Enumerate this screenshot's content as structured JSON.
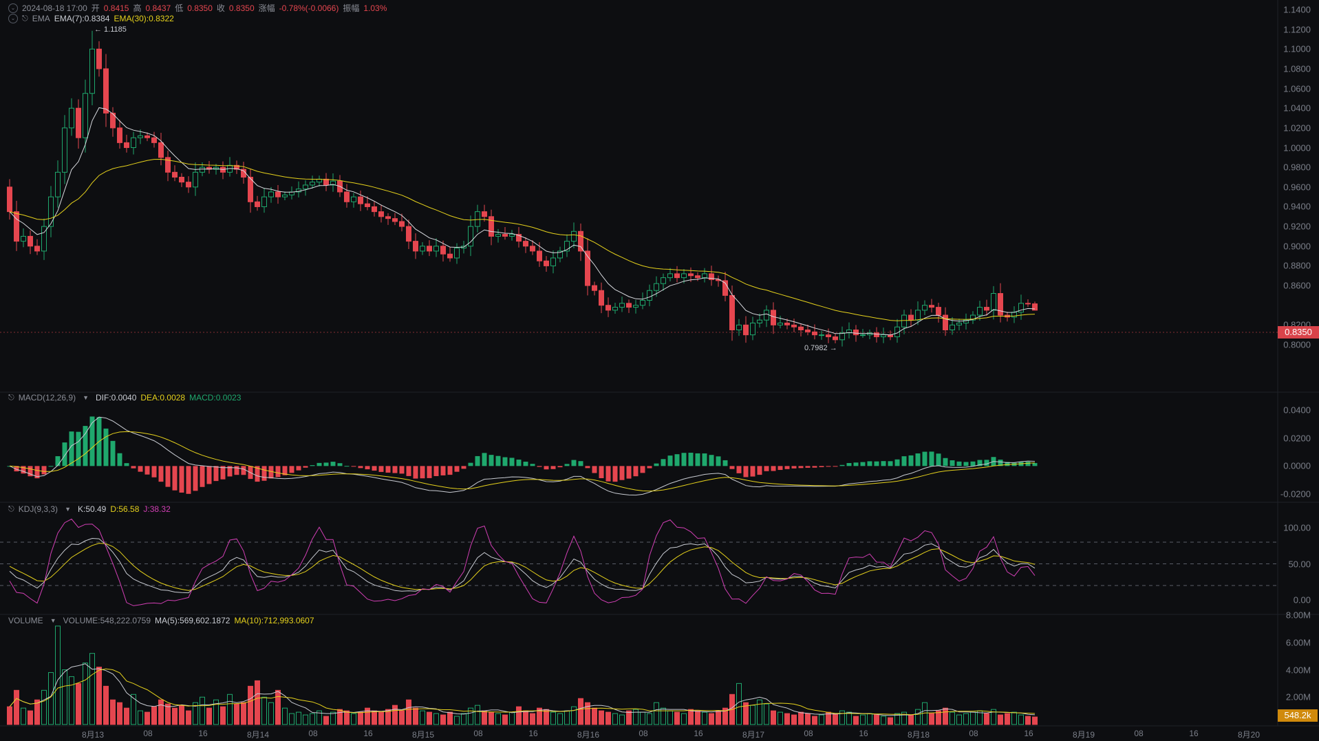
{
  "header": {
    "datetime": "2024-08-18 17:00",
    "open_label": "开",
    "open": "0.8415",
    "high_label": "高",
    "high": "0.8437",
    "low_label": "低",
    "low": "0.8350",
    "close_label": "收",
    "close": "0.8350",
    "change_label": "涨幅",
    "change": "-0.78%(-0.0066)",
    "amplitude_label": "振幅",
    "amplitude": "1.03%"
  },
  "ema_legend": {
    "name": "EMA",
    "ema7": "EMA(7):0.8384",
    "ema30": "EMA(30):0.8322"
  },
  "macd_legend": {
    "name": "MACD(12,26,9)",
    "dif": "DIF:0.0040",
    "dea": "DEA:0.0028",
    "macd": "MACD:0.0023"
  },
  "kdj_legend": {
    "name": "KDJ(9,3,3)",
    "k": "K:50.49",
    "d": "D:56.58",
    "j": "J:38.32"
  },
  "volume_legend": {
    "name": "VOLUME",
    "volume": "VOLUME:548,222.0759",
    "ma5": "MA(5):569,602.1872",
    "ma10": "MA(10):712,993.0607"
  },
  "price_axis": [
    "1.1400",
    "1.1200",
    "1.1000",
    "1.0800",
    "1.0600",
    "1.0400",
    "1.0200",
    "1.0000",
    "0.9800",
    "0.9600",
    "0.9400",
    "0.9200",
    "0.9000",
    "0.8800",
    "0.8600",
    "0.8200",
    "0.8000"
  ],
  "macd_axis": [
    "0.0400",
    "0.0200",
    "0.0000",
    "-0.0200"
  ],
  "kdj_axis": [
    "100.00",
    "50.00",
    "0.00"
  ],
  "volume_axis": [
    "8.00M",
    "6.00M",
    "4.00M",
    "2.00M"
  ],
  "current_price_tag": "0.8350",
  "current_volume_tag": "548.2k",
  "annotations": {
    "high": "← 1.1185",
    "low": "0.7982 →",
    "high_value": 1.1185,
    "low_value": 0.7982
  },
  "x_axis": [
    "8月13",
    "08",
    "16",
    "8月14",
    "08",
    "16",
    "8月15",
    "08",
    "16",
    "8月16",
    "08",
    "16",
    "8月17",
    "08",
    "16",
    "8月18",
    "08",
    "16",
    "8月19",
    "08",
    "16",
    "8月20"
  ],
  "colors": {
    "up": "#1fa86d",
    "down": "#e5464f",
    "ema7": "#d9dbe0",
    "ema30": "#e6d21c",
    "j": "#d23fb5",
    "volume_tag": "#d08a0c"
  },
  "chart_data": {
    "type": "candlestick",
    "interval": "1h",
    "first_open": 0.96,
    "last_open": 0.8415,
    "closes": [
      0.935,
      0.905,
      0.91,
      0.9,
      0.895,
      0.92,
      0.95,
      0.975,
      1.02,
      1.04,
      1.01,
      1.055,
      1.1,
      1.08,
      1.035,
      1.02,
      1.005,
      1.0,
      1.01,
      1.012,
      1.01,
      1.005,
      0.99,
      0.975,
      0.97,
      0.965,
      0.96,
      0.975,
      0.98,
      0.978,
      0.98,
      0.975,
      0.982,
      0.978,
      0.97,
      0.945,
      0.94,
      0.95,
      0.955,
      0.95,
      0.952,
      0.955,
      0.958,
      0.962,
      0.965,
      0.968,
      0.962,
      0.966,
      0.955,
      0.945,
      0.95,
      0.943,
      0.94,
      0.935,
      0.93,
      0.928,
      0.925,
      0.92,
      0.905,
      0.895,
      0.9,
      0.895,
      0.9,
      0.892,
      0.888,
      0.898,
      0.9,
      0.92,
      0.935,
      0.93,
      0.91,
      0.912,
      0.91,
      0.912,
      0.905,
      0.9,
      0.895,
      0.885,
      0.88,
      0.888,
      0.895,
      0.905,
      0.915,
      0.895,
      0.86,
      0.855,
      0.84,
      0.835,
      0.838,
      0.842,
      0.838,
      0.84,
      0.845,
      0.855,
      0.862,
      0.868,
      0.872,
      0.868,
      0.872,
      0.87,
      0.868,
      0.872,
      0.866,
      0.865,
      0.85,
      0.815,
      0.82,
      0.81,
      0.822,
      0.825,
      0.835,
      0.82,
      0.822,
      0.82,
      0.818,
      0.815,
      0.813,
      0.81,
      0.81,
      0.808,
      0.805,
      0.812,
      0.815,
      0.81,
      0.81,
      0.812,
      0.808,
      0.81,
      0.808,
      0.818,
      0.83,
      0.825,
      0.835,
      0.84,
      0.838,
      0.83,
      0.815,
      0.82,
      0.822,
      0.825,
      0.83,
      0.838,
      0.835,
      0.852,
      0.83,
      0.828,
      0.833,
      0.842,
      0.8415,
      0.835
    ],
    "volumes_m": [
      1.3,
      2.5,
      1.2,
      1.0,
      1.8,
      2.5,
      3.8,
      7.2,
      4.0,
      3.5,
      3.0,
      4.5,
      5.2,
      4.2,
      2.8,
      1.8,
      1.6,
      1.2,
      2.2,
      1.0,
      0.9,
      1.3,
      1.8,
      1.5,
      1.2,
      1.4,
      1.0,
      1.6,
      2.0,
      1.2,
      1.8,
      1.3,
      2.2,
      1.5,
      1.6,
      2.8,
      3.2,
      2.0,
      1.6,
      2.5,
      1.2,
      0.8,
      0.9,
      0.7,
      0.8,
      1.0,
      0.6,
      0.9,
      1.1,
      1.0,
      0.8,
      0.9,
      1.2,
      1.0,
      0.9,
      1.1,
      1.4,
      1.0,
      1.8,
      1.2,
      1.0,
      0.9,
      0.8,
      0.7,
      0.9,
      0.6,
      0.8,
      1.2,
      1.4,
      1.0,
      0.9,
      0.8,
      0.7,
      0.9,
      1.3,
      1.0,
      0.8,
      1.2,
      1.1,
      0.9,
      0.8,
      1.0,
      1.3,
      1.9,
      1.6,
      1.2,
      1.0,
      0.9,
      0.8,
      0.7,
      1.0,
      1.1,
      0.9,
      0.8,
      1.6,
      1.2,
      1.0,
      0.9,
      0.8,
      1.1,
      1.0,
      0.9,
      0.8,
      1.0,
      1.2,
      2.2,
      3.0,
      1.6,
      1.4,
      1.8,
      1.5,
      1.0,
      0.9,
      0.8,
      0.7,
      0.9,
      0.8,
      0.6,
      0.7,
      0.9,
      0.8,
      1.0,
      0.9,
      0.6,
      0.7,
      0.8,
      0.7,
      0.6,
      0.5,
      0.8,
      0.9,
      0.7,
      1.1,
      1.6,
      0.8,
      1.0,
      1.2,
      0.9,
      0.7,
      0.8,
      0.9,
      1.0,
      0.8,
      1.1,
      0.7,
      0.8,
      0.9,
      0.7,
      0.6,
      0.55
    ],
    "price_range": [
      0.79,
      1.145
    ],
    "macd_range": [
      -0.03,
      0.05
    ],
    "kdj_range": [
      -10,
      115
    ],
    "volume_range_m": [
      0,
      8.05
    ]
  }
}
